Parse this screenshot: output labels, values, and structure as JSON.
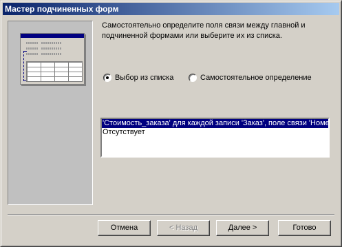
{
  "window": {
    "title": "Мастер подчиненных форм"
  },
  "description": "Самостоятельно определите поля связи между главной и подчиненной формами или выберите их из списка.",
  "options": [
    {
      "label": "Выбор из списка",
      "selected": true
    },
    {
      "label": "Самостоятельное определение",
      "selected": false
    }
  ],
  "list": {
    "items": [
      "'Стоимость_заказа' для каждой записи 'Заказ', поле связи 'Номе",
      "Отсутствует"
    ]
  },
  "buttons": {
    "cancel": "Отмена",
    "back": "< Назад",
    "next": "Далее >",
    "finish": "Готово"
  }
}
